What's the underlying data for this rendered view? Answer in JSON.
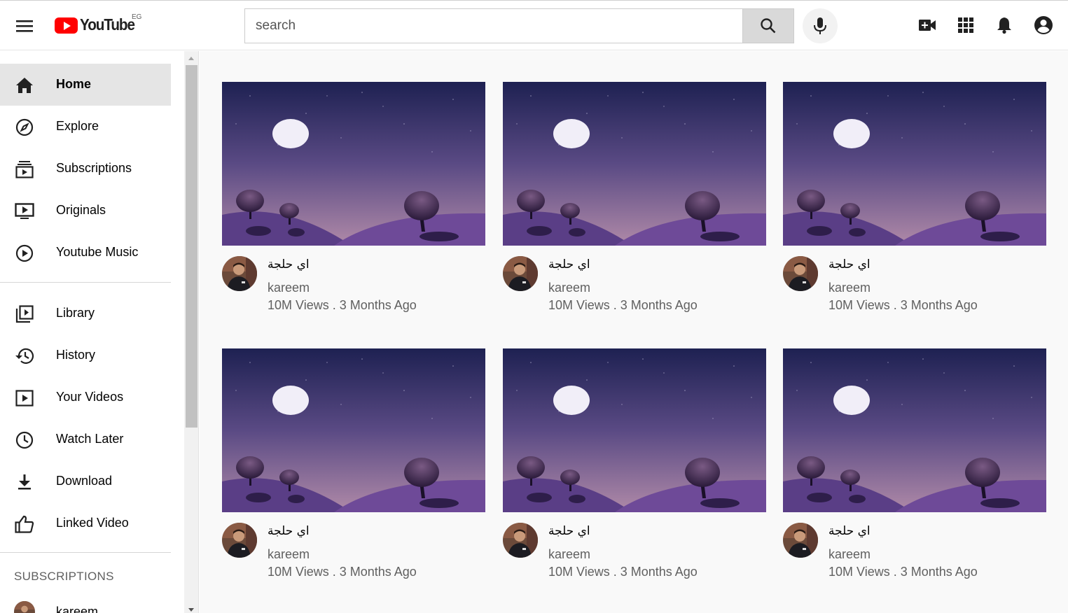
{
  "header": {
    "logo_text": "YouTube",
    "country_code": "EG",
    "search_placeholder": "search"
  },
  "sidebar": {
    "primary": [
      {
        "label": "Home",
        "icon": "home-icon",
        "active": true
      },
      {
        "label": "Explore",
        "icon": "compass-icon"
      },
      {
        "label": "Subscriptions",
        "icon": "subscriptions-icon"
      },
      {
        "label": "Originals",
        "icon": "originals-icon"
      },
      {
        "label": "Youtube Music",
        "icon": "music-play-icon"
      }
    ],
    "secondary": [
      {
        "label": "Library",
        "icon": "library-icon"
      },
      {
        "label": "History",
        "icon": "history-icon"
      },
      {
        "label": "Your Videos",
        "icon": "your-videos-icon"
      },
      {
        "label": "Watch Later",
        "icon": "clock-icon"
      },
      {
        "label": "Download",
        "icon": "download-icon"
      },
      {
        "label": "Linked Video",
        "icon": "thumbs-up-icon"
      }
    ],
    "subscriptions_title": "SUBSCRIPTIONS",
    "subscriptions": [
      {
        "name": "kareem"
      }
    ]
  },
  "videos": [
    {
      "title": "اي حلجة",
      "channel": "kareem",
      "meta": "10M Views . 3 Months Ago"
    },
    {
      "title": "اي حلجة",
      "channel": "kareem",
      "meta": "10M Views . 3 Months Ago"
    },
    {
      "title": "اي حلجة",
      "channel": "kareem",
      "meta": "10M Views . 3 Months Ago"
    },
    {
      "title": "اي حلجة",
      "channel": "kareem",
      "meta": "10M Views . 3 Months Ago"
    },
    {
      "title": "اي حلجة",
      "channel": "kareem",
      "meta": "10M Views . 3 Months Ago"
    },
    {
      "title": "اي حلجة",
      "channel": "kareem",
      "meta": "10M Views . 3 Months Ago"
    }
  ],
  "colors": {
    "brand_red": "#ff0000",
    "active_bg": "#e5e5e5",
    "secondary_text": "#606060"
  }
}
